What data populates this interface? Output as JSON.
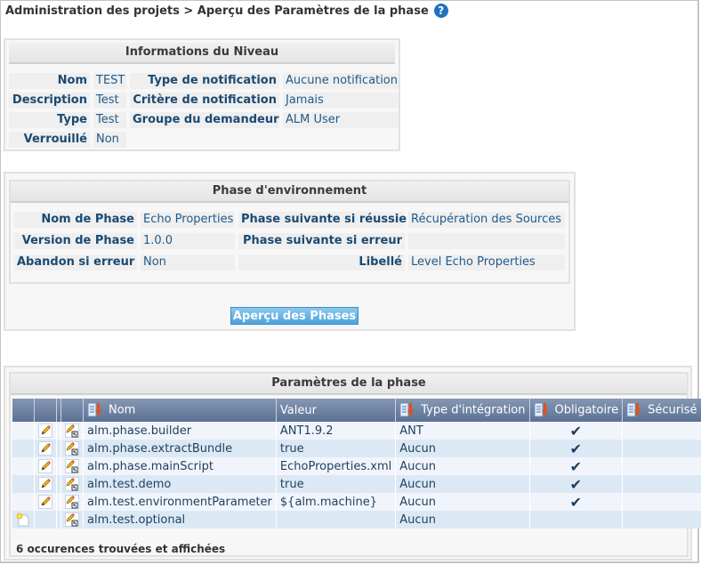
{
  "breadcrumb": {
    "text": "Administration des projets > Aperçu des Paramètres de la phase",
    "help_icon": "question-circle-icon"
  },
  "info_panel": {
    "title": "Informations du Niveau",
    "rows": [
      {
        "label1": "Nom",
        "value1": "TEST",
        "label2": "Type de notification",
        "value2": "Aucune notification"
      },
      {
        "label1": "Description",
        "value1": "Test",
        "label2": "Critère de notification",
        "value2": "Jamais"
      },
      {
        "label1": "Type",
        "value1": "Test",
        "label2": "Groupe du demandeur",
        "value2": "ALM User"
      },
      {
        "label1": "Verrouillé",
        "value1": "Non"
      }
    ]
  },
  "phase_panel": {
    "title": "Phase d'environnement",
    "rows": [
      {
        "label1": "Nom de Phase",
        "value1": "Echo Properties",
        "label2": "Phase suivante si réussie",
        "value2": "Récupération des Sources"
      },
      {
        "label1": "Version de Phase",
        "value1": "1.0.0",
        "label2": "Phase suivante si erreur",
        "value2": ""
      },
      {
        "label1": "Abandon si erreur",
        "value1": "Non",
        "label2": "Libellé",
        "value2": "Level Echo Properties"
      }
    ],
    "button_label": "Aperçu des Phases"
  },
  "params_panel": {
    "title": "Paramètres de la phase",
    "columns": [
      "Nom",
      "Valeur",
      "Type d'intégration",
      "Obligatoire",
      "Sécurisé"
    ],
    "rows": [
      {
        "action": "edit",
        "name": "alm.phase.builder",
        "value": "ANT1.9.2",
        "integration": "ANT",
        "mandatory": "✔",
        "secure": ""
      },
      {
        "action": "edit",
        "name": "alm.phase.extractBundle",
        "value": "true",
        "integration": "Aucun",
        "mandatory": "✔",
        "secure": ""
      },
      {
        "action": "edit",
        "name": "alm.phase.mainScript",
        "value": "EchoProperties.xml",
        "integration": "Aucun",
        "mandatory": "✔",
        "secure": ""
      },
      {
        "action": "edit",
        "name": "alm.test.demo",
        "value": "true",
        "integration": "Aucun",
        "mandatory": "✔",
        "secure": ""
      },
      {
        "action": "edit",
        "name": "alm.test.environmentParameter",
        "value": "${alm.machine}",
        "integration": "Aucun",
        "mandatory": "✔",
        "secure": ""
      },
      {
        "action": "new",
        "name": "alm.test.optional",
        "value": "",
        "integration": "Aucun",
        "mandatory": "",
        "secure": ""
      }
    ],
    "footer": "6 occurences trouvées et affichées"
  },
  "colors": {
    "header_gradient_top": "#8597b3",
    "header_gradient_bottom": "#5b7194",
    "row_odd": "#f1f5fb",
    "row_even": "#dce9f5",
    "check_red": "#e01b1b",
    "button_blue": "#4aa3dc"
  }
}
